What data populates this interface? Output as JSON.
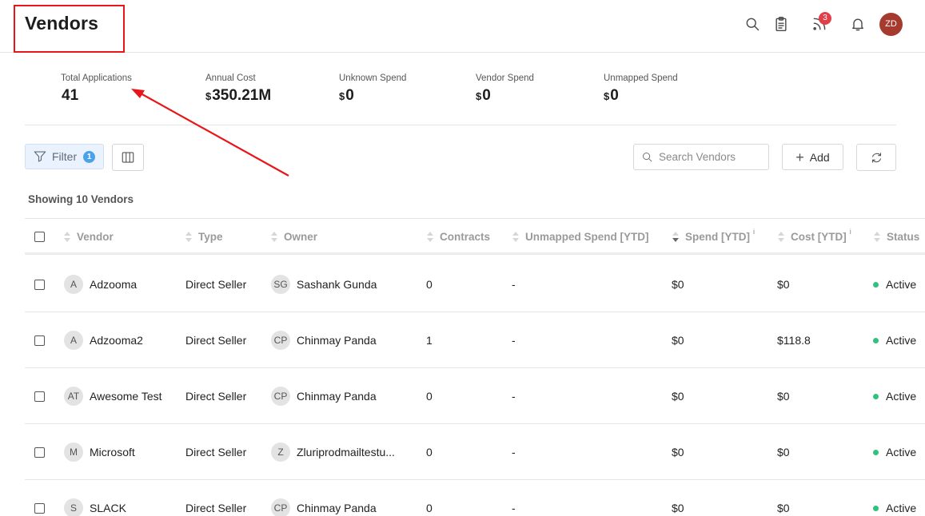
{
  "header": {
    "title": "Vendors",
    "icons": [
      "search-icon",
      "clipboard-icon",
      "feed-icon",
      "bell-icon"
    ],
    "notification_count": "3",
    "avatar_initials": "ZD",
    "avatar_color": "#a63a2e",
    "highlight_color": "#e8161b"
  },
  "stats": [
    {
      "label": "Total Applications",
      "value": "41",
      "currency": ""
    },
    {
      "label": "Annual Cost",
      "value": "350.21M",
      "currency": "$"
    },
    {
      "label": "Unknown Spend",
      "value": "0",
      "currency": "$"
    },
    {
      "label": "Vendor Spend",
      "value": "0",
      "currency": "$"
    },
    {
      "label": "Unmapped Spend",
      "value": "0",
      "currency": "$"
    }
  ],
  "toolbar": {
    "filter_label": "Filter",
    "filter_count": "1",
    "search_placeholder": "Search Vendors",
    "add_label": "Add"
  },
  "showing_text": "Showing 10 Vendors",
  "table": {
    "columns": [
      "Vendor",
      "Type",
      "Owner",
      "Contracts",
      "Unmapped Spend [YTD]",
      "Spend [YTD]",
      "Cost [YTD]",
      "Status"
    ],
    "info_marker": "i",
    "rows": [
      {
        "vendor_initials": "A",
        "vendor": "Adzooma",
        "type": "Direct Seller",
        "owner_initials": "SG",
        "owner": "Sashank Gunda",
        "contracts": "0",
        "unmapped": "-",
        "spend": "$0",
        "cost": "$0",
        "status": "Active"
      },
      {
        "vendor_initials": "A",
        "vendor": "Adzooma2",
        "type": "Direct Seller",
        "owner_initials": "CP",
        "owner": "Chinmay Panda",
        "contracts": "1",
        "unmapped": "-",
        "spend": "$0",
        "cost": "$118.8",
        "status": "Active"
      },
      {
        "vendor_initials": "AT",
        "vendor": "Awesome Test",
        "type": "Direct Seller",
        "owner_initials": "CP",
        "owner": "Chinmay Panda",
        "contracts": "0",
        "unmapped": "-",
        "spend": "$0",
        "cost": "$0",
        "status": "Active"
      },
      {
        "vendor_initials": "M",
        "vendor": "Microsoft",
        "type": "Direct Seller",
        "owner_initials": "Z",
        "owner": "Zluriprodmailtestu...",
        "contracts": "0",
        "unmapped": "-",
        "spend": "$0",
        "cost": "$0",
        "status": "Active"
      },
      {
        "vendor_initials": "S",
        "vendor": "SLACK",
        "type": "Direct Seller",
        "owner_initials": "CP",
        "owner": "Chinmay Panda",
        "contracts": "0",
        "unmapped": "-",
        "spend": "$0",
        "cost": "$0",
        "status": "Active"
      }
    ]
  }
}
